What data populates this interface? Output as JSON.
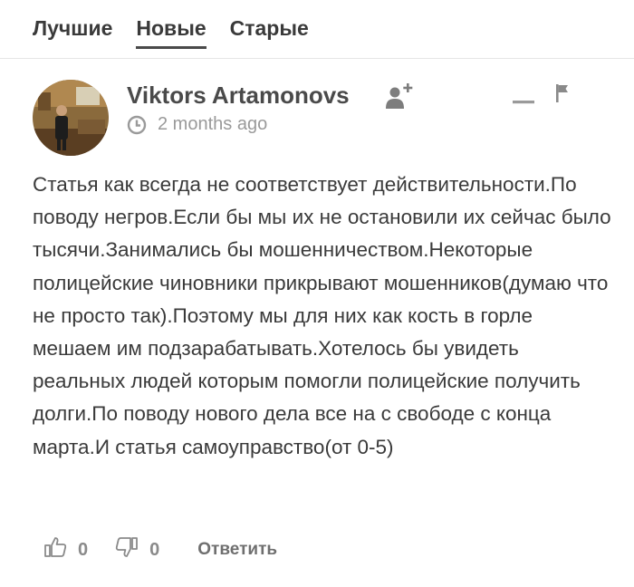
{
  "tabs": [
    {
      "label": "Лучшие",
      "active": false
    },
    {
      "label": "Новые",
      "active": true
    },
    {
      "label": "Старые",
      "active": false
    }
  ],
  "comment": {
    "author": "Viktors Artamonovs",
    "time": "2 months ago",
    "text": "Статья как всегда не соответствует действительности.По поводу негров.Если бы мы их не остановили их сейчас было тысячи.Занимались бы мошенничеством.Некоторые полицейские чиновники прикрывают мошенников(думаю что не просто так).Поэтому мы для них как кость в горле мешаем им подзарабатывать.Хотелось бы увидеть реальных людей которым помогли полицейские получить долги.По поводу нового дела все на с свободе с конца марта.И статья самоуправство(от 0-5)",
    "likes": "0",
    "dislikes": "0",
    "reply_label": "Ответить"
  },
  "icons": {
    "follow": "add-user-icon",
    "minimize": "minus-icon",
    "report": "flag-icon",
    "time": "clock-icon",
    "like": "thumbs-up-icon",
    "dislike": "thumbs-down-icon"
  },
  "colors": {
    "text": "#3a3a3a",
    "muted": "#9a9a9a",
    "icon": "#8a8a8a"
  }
}
